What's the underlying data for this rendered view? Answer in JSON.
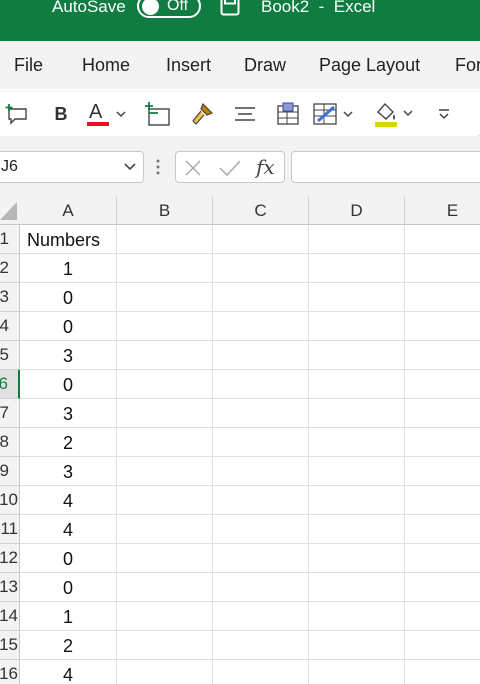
{
  "titlebar": {
    "autosave_label": "AutoSave",
    "autosave_state": "Off",
    "title": "Book2  -  Excel",
    "bg_color": "#107c41"
  },
  "menu": {
    "tabs": [
      "File",
      "Home",
      "Insert",
      "Draw",
      "Page Layout",
      "For"
    ]
  },
  "ribbon": {
    "items": [
      {
        "name": "new-comment-icon"
      },
      {
        "name": "bold-icon",
        "label": "B"
      },
      {
        "name": "font-color-icon",
        "label": "A",
        "color": "#e81123"
      },
      {
        "name": "insert-cells-icon"
      },
      {
        "name": "format-painter-icon"
      },
      {
        "name": "align-icon"
      },
      {
        "name": "cell-styles-icon"
      },
      {
        "name": "format-as-table-icon"
      },
      {
        "name": "fill-color-icon",
        "color": "#d8d400"
      },
      {
        "name": "more-options-icon"
      }
    ]
  },
  "formula_bar": {
    "name_box": "J6",
    "fx_label": "fx",
    "formula": ""
  },
  "grid": {
    "columns": [
      "A",
      "B",
      "C",
      "D",
      "E"
    ],
    "active_row": 6,
    "rows": [
      {
        "row": "1",
        "a": "Numbers"
      },
      {
        "row": "2",
        "a": "1"
      },
      {
        "row": "3",
        "a": "0"
      },
      {
        "row": "4",
        "a": "0"
      },
      {
        "row": "5",
        "a": "3"
      },
      {
        "row": "6",
        "a": "0"
      },
      {
        "row": "7",
        "a": "3"
      },
      {
        "row": "8",
        "a": "2"
      },
      {
        "row": "9",
        "a": "3"
      },
      {
        "row": "10",
        "a": "4"
      },
      {
        "row": "11",
        "a": "4"
      },
      {
        "row": "12",
        "a": "0"
      },
      {
        "row": "13",
        "a": "0"
      },
      {
        "row": "14",
        "a": "1"
      },
      {
        "row": "15",
        "a": "2"
      },
      {
        "row": "16",
        "a": "4"
      }
    ]
  }
}
